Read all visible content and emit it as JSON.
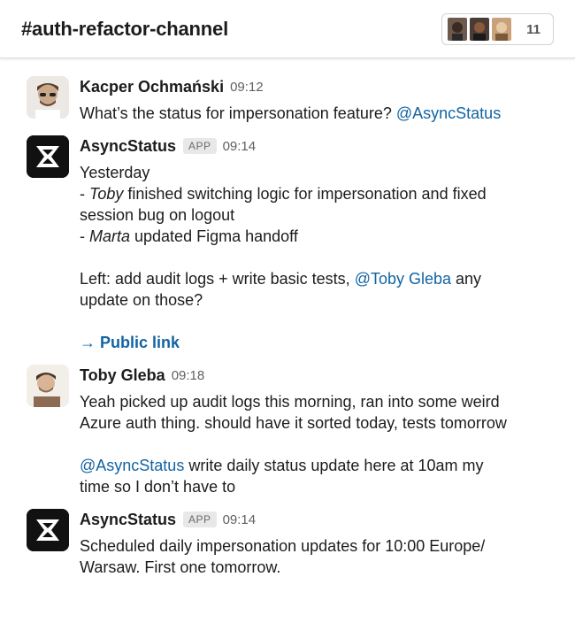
{
  "header": {
    "channel": "#auth-refactor-channel",
    "member_count": "11"
  },
  "messages": [
    {
      "author": "Kacper Ochmański",
      "time": "09:12",
      "text": "What’s the status for impersonation feature?",
      "mention": "@AsyncStatus"
    },
    {
      "author": "AsyncStatus",
      "badge": "APP",
      "time": "09:14",
      "l1": "Yesterday",
      "l2_prefix": "- ",
      "l2_name": "Toby",
      "l2_rest": " finished switching logic for impersonation and fixed",
      "l3": "session bug on logout",
      "l4_prefix": "- ",
      "l4_name": "Marta",
      "l4_rest": " updated Figma handoff",
      "l5_text": "Left: add audit logs + write basic tests,",
      "l5_mention": "@Toby Gleba",
      "l5_rest": " any",
      "l6": "update on those?",
      "link": "→ Public link"
    },
    {
      "author": "Toby Gleba",
      "time": "09:18",
      "l1": "Yeah picked up audit logs this morning, ran into some weird",
      "l2": "Azure auth thing. should have it sorted today, tests tomorrow",
      "l3_mention": "@AsyncStatus",
      "l3_rest": " write daily status update here at 10am my",
      "l4": "time so I don’t have to"
    },
    {
      "author": "AsyncStatus",
      "badge": "APP",
      "time": "09:14",
      "l1": "Scheduled daily impersonation updates for 10:00 Europe/",
      "l2": "Warsaw. First one tomorrow."
    }
  ],
  "icons": {
    "app_avatar": "hourglass-logo-icon",
    "person_avatar": "user-photo"
  },
  "colors": {
    "mention": "#1264a3",
    "badge_bg": "#e8e8e8",
    "app_avatar_bg": "#111111"
  }
}
